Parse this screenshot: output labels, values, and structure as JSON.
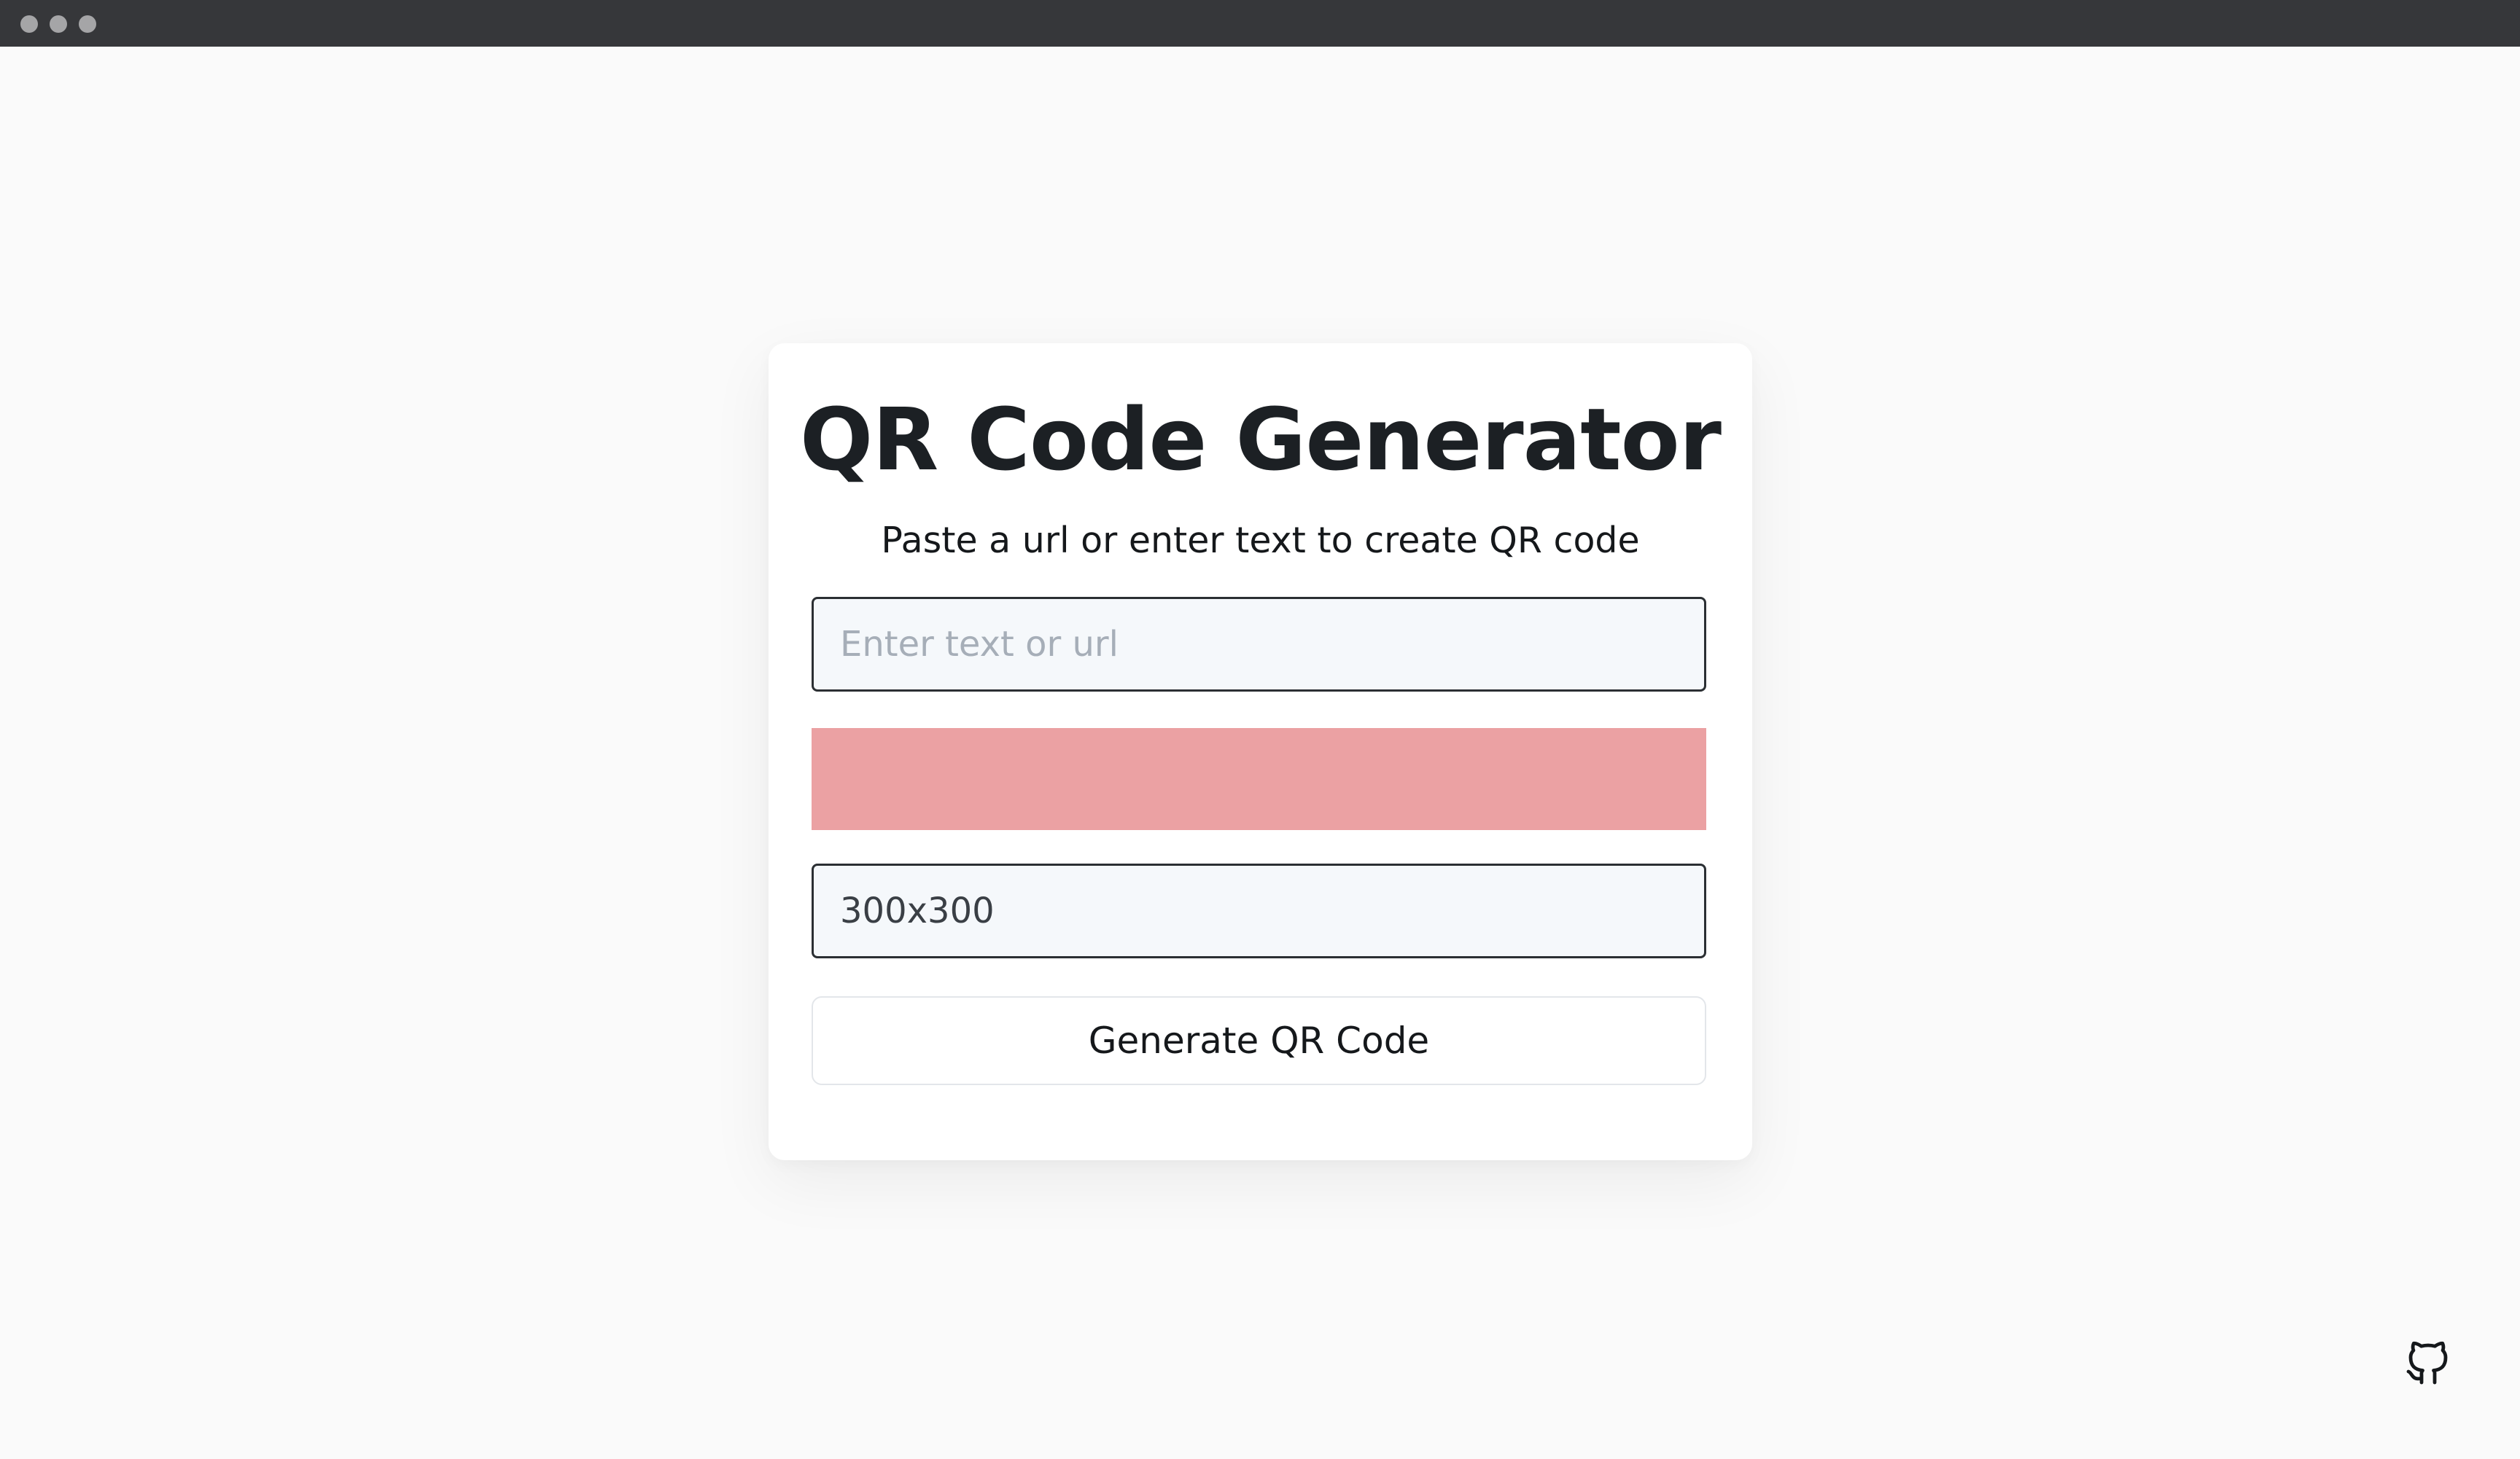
{
  "window": {
    "controls": [
      "close-dot",
      "minimize-dot",
      "maximize-dot"
    ]
  },
  "card": {
    "title": "QR Code Generator",
    "subtitle": "Paste a url or enter text to create QR code",
    "text_input": {
      "placeholder": "Enter text or url",
      "value": ""
    },
    "color_picker": {
      "value": "#eba1a3"
    },
    "size_input": {
      "value": "300x300"
    },
    "generate_button": {
      "label": "Generate QR Code"
    }
  },
  "footer": {
    "github_icon": "github-icon"
  }
}
